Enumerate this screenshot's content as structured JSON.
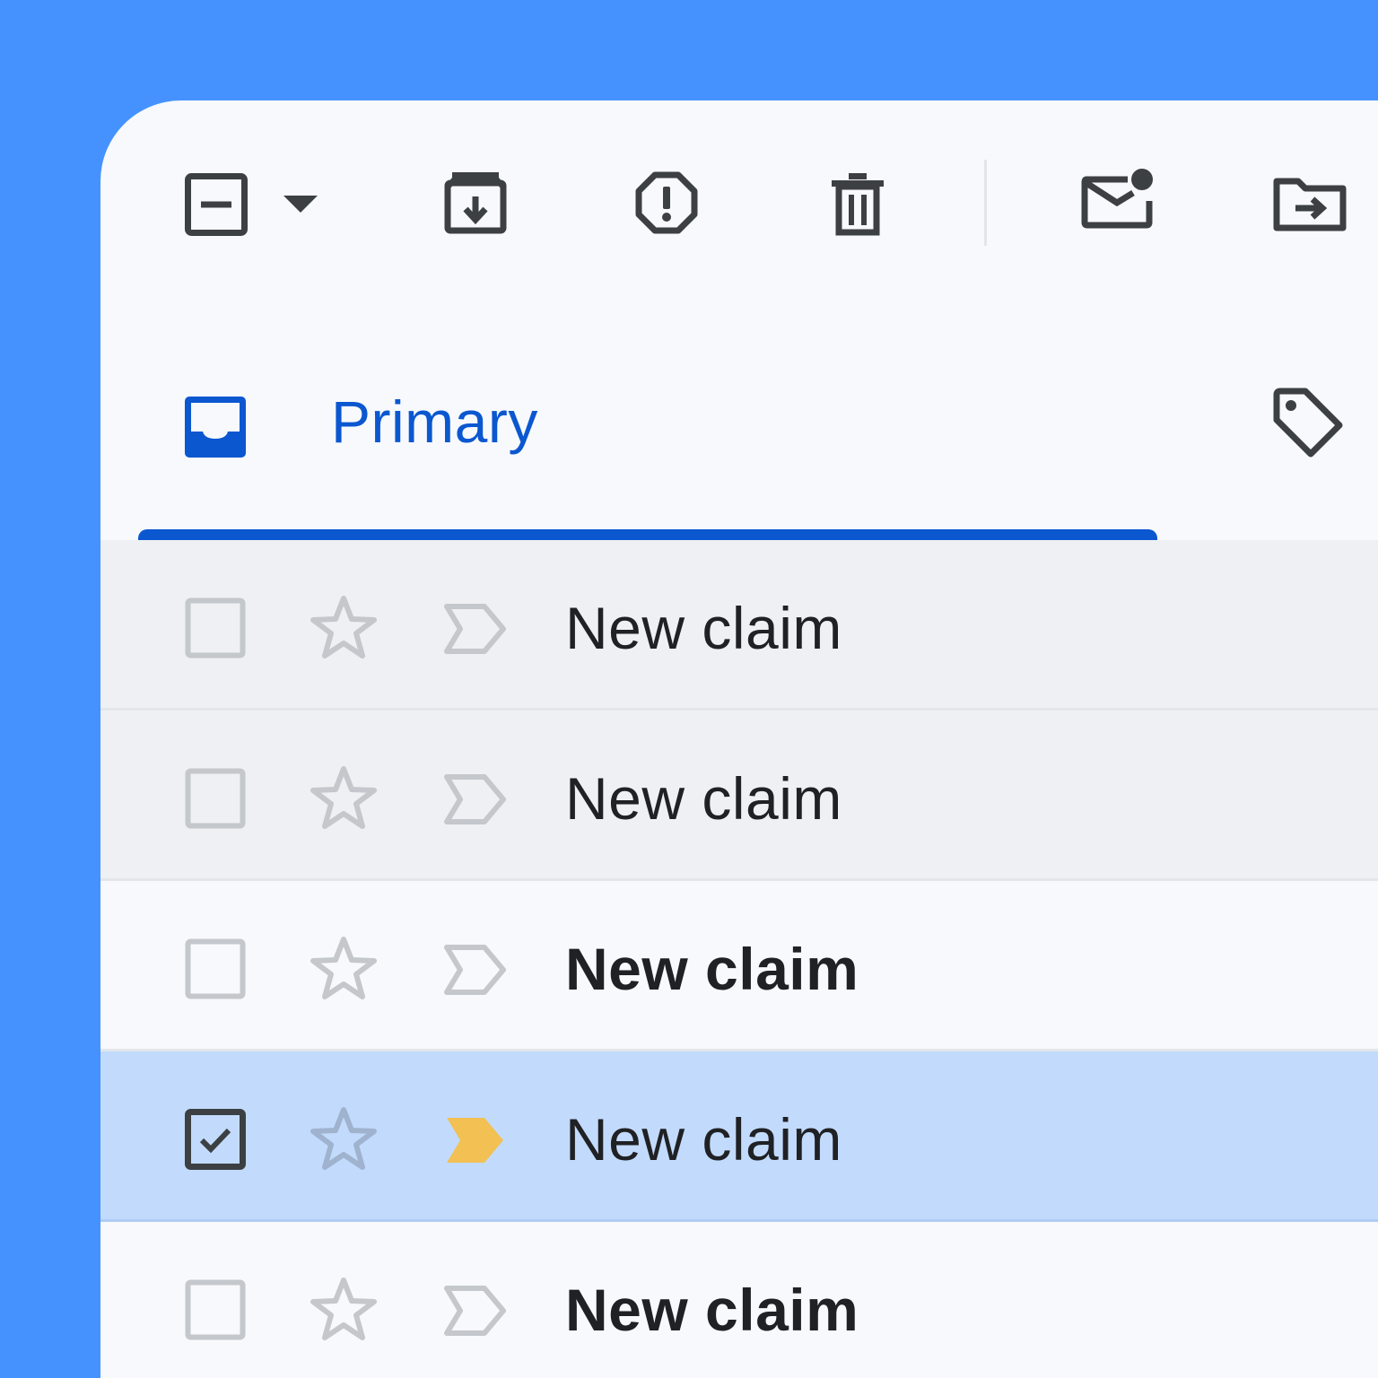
{
  "colors": {
    "background": "#4592ff",
    "window": "#f7f9fc",
    "accent": "#0b57d0",
    "read_row": "#eef0f3",
    "selected_row": "#c2dbfd",
    "important_marker": "#f2c053"
  },
  "toolbar": {
    "icons": [
      "deselect-checkbox-icon",
      "dropdown-caret-icon",
      "archive-icon",
      "report-spam-icon",
      "delete-icon",
      "mark-unread-icon",
      "move-to-icon"
    ]
  },
  "tabs": [
    {
      "label": "Primary",
      "icon": "inbox-icon",
      "active": true
    }
  ],
  "emails": [
    {
      "subject": "New claim",
      "read": true,
      "selected": false,
      "important": false
    },
    {
      "subject": "New claim",
      "read": true,
      "selected": false,
      "important": false
    },
    {
      "subject": "New claim",
      "read": false,
      "selected": false,
      "important": false
    },
    {
      "subject": "New claim",
      "read": true,
      "selected": true,
      "important": true
    },
    {
      "subject": "New claim",
      "read": false,
      "selected": false,
      "important": false
    }
  ]
}
